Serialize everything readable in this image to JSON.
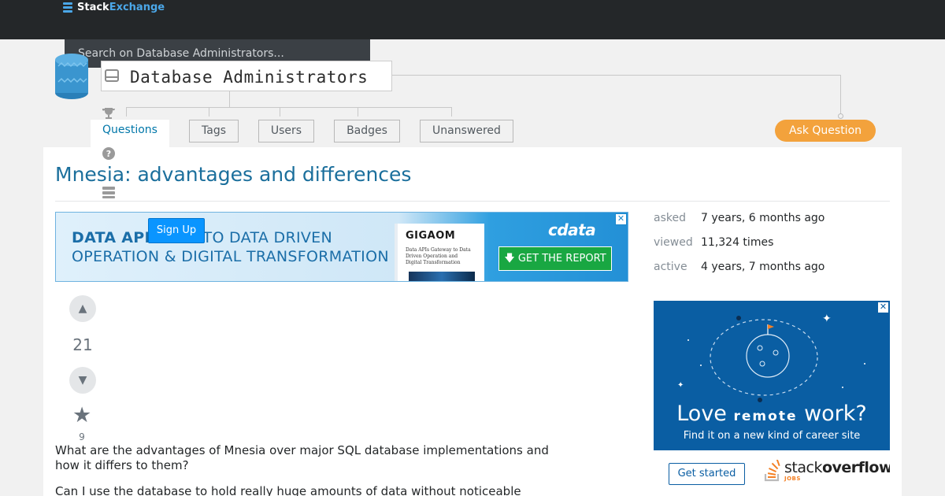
{
  "topbar": {
    "logo_stack": "Stack",
    "logo_exchange": "Exchange"
  },
  "search": {
    "placeholder": "Search on Database Administrators..."
  },
  "site": {
    "name": "Database Administrators"
  },
  "nav": {
    "tabs": [
      {
        "label": "Questions",
        "active": true
      },
      {
        "label": "Tags"
      },
      {
        "label": "Users"
      },
      {
        "label": "Badges"
      },
      {
        "label": "Unanswered"
      }
    ],
    "ask_label": "Ask Question"
  },
  "question": {
    "title": "Mnesia: advantages and differences",
    "votes": "21",
    "favorites": "9",
    "body": [
      "What are the advantages of Mnesia over major SQL database implementations and how it differs to them?",
      "Can I use the database to hold really huge amounts of data without noticeable"
    ]
  },
  "banner_ad": {
    "line1_bold": "DATA APIs",
    "line1_rest": "WAY TO DATA DRIVEN",
    "line2": "OPERATION & DIGITAL TRANSFORMATION",
    "book_brand": "GIGAOM",
    "book_text": "Data APIs Gateway to Data Driven Operation and Digital Transformation",
    "brand": "cdata",
    "cta": "GET THE REPORT",
    "close": "✕"
  },
  "signup_label": "Sign Up",
  "stats": {
    "asked_label": "asked",
    "asked_value": "7 years, 6 months ago",
    "viewed_label": "viewed",
    "viewed_value": "11,324 times",
    "active_label": "active",
    "active_value": "4 years, 7 months ago"
  },
  "jobs_ad": {
    "headline_love": "Love",
    "headline_remote": "remote",
    "headline_work": "work?",
    "subline": "Find it on a new kind of career site",
    "cta": "Get started",
    "logo_stack": "stack",
    "logo_overflow": "overflow",
    "logo_jobs": "JOBS",
    "close": "✕"
  },
  "colors": {
    "topbar": "#242729",
    "link": "#1b6f9c",
    "ask_button": "#f3a23c",
    "ad_blue": "#0a5ea3"
  }
}
